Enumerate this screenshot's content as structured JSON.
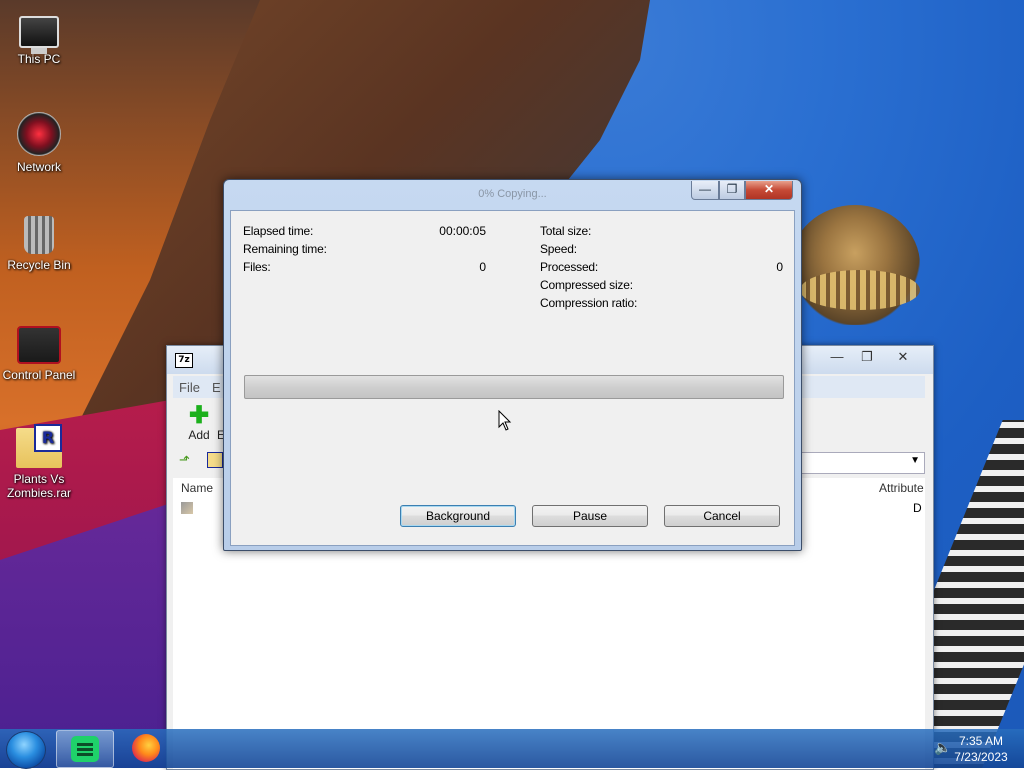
{
  "desktop": {
    "icons": [
      {
        "label": "This PC",
        "icon": "computer-icon"
      },
      {
        "label": "Network",
        "icon": "network-icon"
      },
      {
        "label": "Recycle Bin",
        "icon": "recycle-bin-icon"
      },
      {
        "label": "Control Panel",
        "icon": "control-panel-icon"
      },
      {
        "label": "Plants Vs Zombies.rar",
        "icon": "rar-archive-icon"
      }
    ]
  },
  "file_manager": {
    "app_icon_text": "7z",
    "menu": [
      "File",
      "E"
    ],
    "toolbar": {
      "add_label": "Add",
      "next_label": "E"
    },
    "columns": {
      "name": "Name",
      "attributes": "Attribute"
    },
    "row_attr": "D",
    "controls": {
      "minimize": "—",
      "maximize": "❐",
      "close": "✕"
    }
  },
  "dialog": {
    "title": "0% Copying...",
    "controls": {
      "minimize": "—",
      "maximize": "❐",
      "close": "✕"
    },
    "left": {
      "elapsed_label": "Elapsed time:",
      "elapsed_value": "00:00:05",
      "remaining_label": "Remaining time:",
      "remaining_value": "",
      "files_label": "Files:",
      "files_value": "0"
    },
    "right": {
      "total_size_label": "Total size:",
      "total_size_value": "",
      "speed_label": "Speed:",
      "speed_value": "",
      "processed_label": "Processed:",
      "processed_value": "0",
      "compressed_size_label": "Compressed size:",
      "compression_ratio_label": "Compression ratio:"
    },
    "progress": 0,
    "buttons": {
      "background": "Background",
      "pause": "Pause",
      "cancel": "Cancel"
    }
  },
  "taskbar": {
    "apps": [
      "start-orb",
      "notes-app",
      "firefox"
    ],
    "time": "7:35 AM",
    "date": "7/23/2023"
  }
}
